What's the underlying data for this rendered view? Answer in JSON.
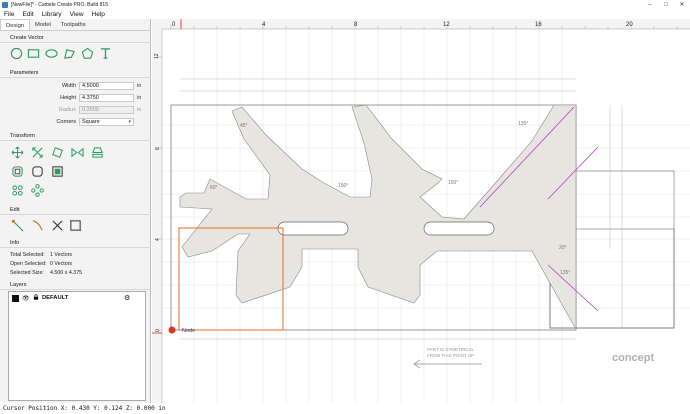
{
  "window": {
    "title": "[NewFile]* - Carbide Create PRO, Build 815"
  },
  "menu": {
    "file": "File",
    "edit": "Edit",
    "library": "Library",
    "view": "View",
    "help": "Help"
  },
  "tabs": {
    "design": "Design",
    "model": "Model",
    "toolpaths": "Toolpaths"
  },
  "sections": {
    "create_vector": "Create Vector",
    "parameters": "Parameters",
    "transform": "Transform",
    "edit": "Edit",
    "info": "Info",
    "layers": "Layers"
  },
  "parameters": {
    "width_label": "Width",
    "width_value": "4.5000",
    "width_unit": "in",
    "height_label": "Height",
    "height_value": "4.3750",
    "height_unit": "in",
    "radius_label": "Radius",
    "radius_value": "0.2600",
    "radius_unit": "in",
    "corners_label": "Corners",
    "corners_value": "Square"
  },
  "info": {
    "total_selected_label": "Total Selected:",
    "total_selected_value": "1 Vectors",
    "open_selected_label": "Open Selected:",
    "open_selected_value": "0 Vectors",
    "selected_size_label": "Selected Size:",
    "selected_size_value": "4.500 x 4.375"
  },
  "layers": {
    "default_name": "DEFAULT"
  },
  "canvas": {
    "top_ruler_labels": [
      "0",
      "4",
      "8",
      "12",
      "16",
      "20"
    ],
    "left_ruler_labels": [
      "12",
      "8",
      "4",
      "0"
    ],
    "node_label": "Node",
    "logo_text": "concept",
    "annotation_line1": "PART IS SYMETRICAL",
    "annotation_line2": "FROM THIS POINT UP",
    "angle_labels": [
      "45°",
      "150°",
      "135°",
      "150°",
      "60°",
      "20°",
      "135°"
    ]
  },
  "statusbar": {
    "text": "Cursor Position X: 0.430 Y: 0.124 Z: 0.000 in"
  }
}
